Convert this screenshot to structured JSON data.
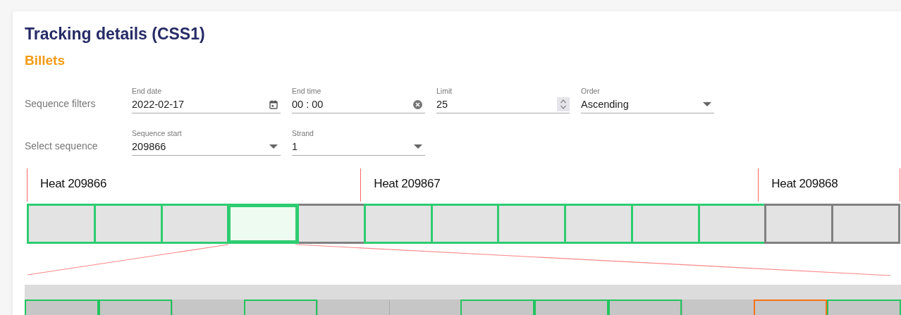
{
  "title": "Tracking details (CSS1)",
  "subtitle": "Billets",
  "filter_rows": [
    {
      "label": "Sequence filters",
      "fields": [
        {
          "kind": "date",
          "label": "End date",
          "value": "2022-02-17"
        },
        {
          "kind": "clearable",
          "label": "End time",
          "value": "00 : 00"
        },
        {
          "kind": "number",
          "label": "Limit",
          "value": "25"
        },
        {
          "kind": "select",
          "label": "Order",
          "value": "Ascending"
        }
      ]
    },
    {
      "label": "Select sequence",
      "fields": [
        {
          "kind": "select",
          "label": "Sequence start",
          "value": "209866"
        },
        {
          "kind": "select",
          "label": "Strand",
          "value": "1"
        }
      ]
    }
  ],
  "heats": [
    {
      "label": "Heat 209866",
      "billets": [
        {
          "color": "#2ecc71",
          "selected": false
        },
        {
          "color": "#2ecc71",
          "selected": false
        },
        {
          "color": "#2ecc71",
          "selected": false
        },
        {
          "color": "#2ecc71",
          "selected": true
        },
        {
          "color": "#808080",
          "selected": false
        }
      ]
    },
    {
      "label": "Heat 209867",
      "billets": [
        {
          "color": "#2ecc71",
          "selected": false
        },
        {
          "color": "#2ecc71",
          "selected": false
        },
        {
          "color": "#2ecc71",
          "selected": false
        },
        {
          "color": "#2ecc71",
          "selected": false
        },
        {
          "color": "#2ecc71",
          "selected": false
        },
        {
          "color": "#2ecc71",
          "selected": false
        }
      ]
    },
    {
      "label": "Heat 209868",
      "billets": [
        {
          "color": "#808080",
          "selected": false
        },
        {
          "color": "#808080",
          "selected": false
        }
      ]
    }
  ],
  "segments": [
    {
      "kind": "outlined",
      "color": "#22c55e"
    },
    {
      "kind": "outlined",
      "color": "#22c55e"
    },
    {
      "kind": "plain"
    },
    {
      "kind": "outlined",
      "color": "#22c55e"
    },
    {
      "kind": "plain"
    },
    {
      "kind": "plain"
    },
    {
      "kind": "outlined",
      "color": "#22c55e"
    },
    {
      "kind": "outlined",
      "color": "#22c55e"
    },
    {
      "kind": "outlined",
      "color": "#22c55e"
    },
    {
      "kind": "plain"
    },
    {
      "kind": "outlined",
      "color": "#f97316"
    },
    {
      "kind": "outlined",
      "color": "#22c55e"
    }
  ]
}
